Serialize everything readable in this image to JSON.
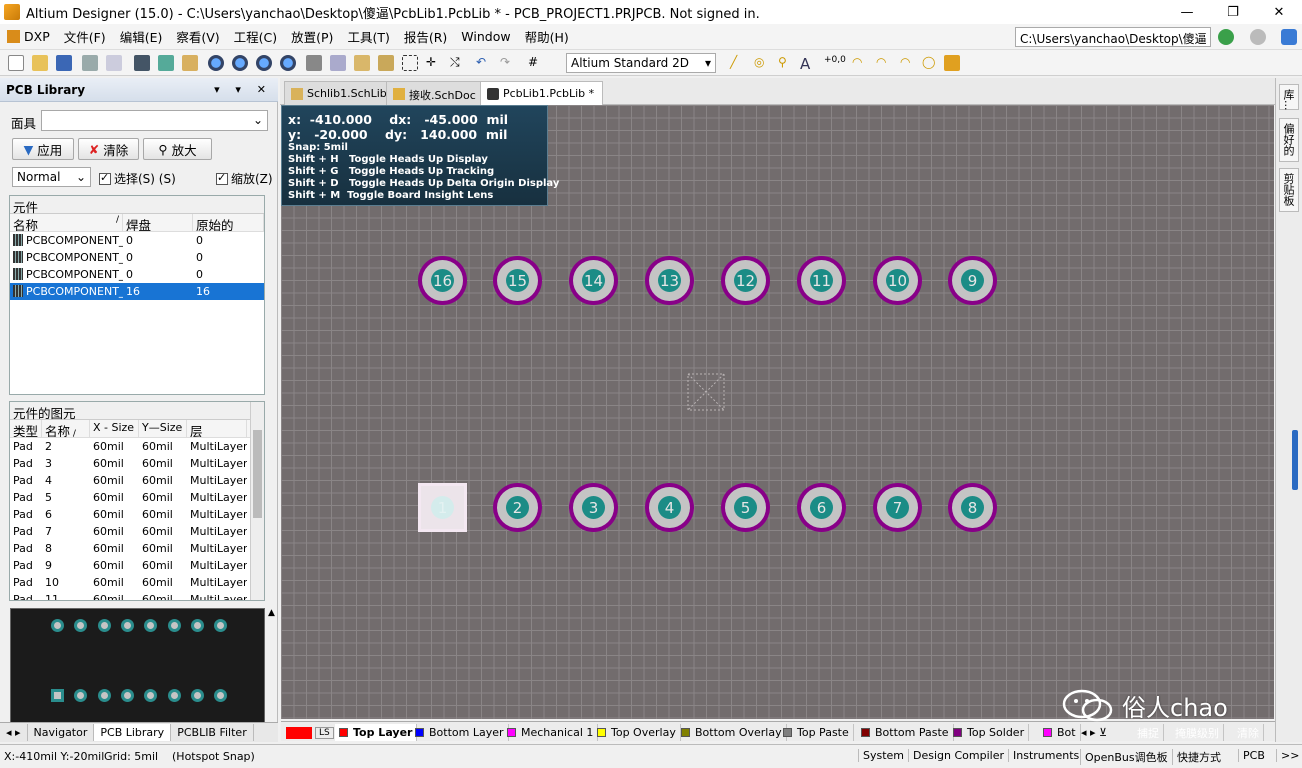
{
  "window": {
    "title": "Altium Designer (15.0) - C:\\Users\\yanchao\\Desktop\\傻逼\\PcbLib1.PcbLib * - PCB_PROJECT1.PRJPCB. Not signed in."
  },
  "menu": [
    "DXP",
    "文件(F)",
    "编辑(E)",
    "察看(V)",
    "工程(C)",
    "放置(P)",
    "工具(T)",
    "报告(R)",
    "Window",
    "帮助(H)"
  ],
  "path_box": "C:\\Users\\yanchao\\Desktop\\傻逼 ▾",
  "toolbar": {
    "view_mode": "Altium Standard 2D"
  },
  "panel": {
    "title": "PCB Library",
    "mask_label": "面具",
    "apply": "应用",
    "clear": "清除",
    "zoom": "放大",
    "filter_mode": "Normal",
    "select_label": "选择(S) (S)",
    "scale_label": "缩放(Z) (Z)",
    "components": {
      "title": "元件",
      "headers": [
        "名称",
        "焊盘",
        "原始的"
      ],
      "rows": [
        {
          "name": "PCBCOMPONENT_",
          "pads": "0",
          "prims": "0"
        },
        {
          "name": "PCBCOMPONENT_",
          "pads": "0",
          "prims": "0"
        },
        {
          "name": "PCBCOMPONENT_",
          "pads": "0",
          "prims": "0"
        },
        {
          "name": "PCBCOMPONENT_",
          "pads": "16",
          "prims": "16"
        }
      ]
    },
    "primitives": {
      "title": "元件的图元",
      "headers": [
        "类型",
        "名称",
        "X - Size",
        "Y—Size",
        "层"
      ],
      "rows": [
        {
          "type": "Pad",
          "name": "2",
          "x": "60mil",
          "y": "60mil",
          "layer": "MultiLayer"
        },
        {
          "type": "Pad",
          "name": "3",
          "x": "60mil",
          "y": "60mil",
          "layer": "MultiLayer"
        },
        {
          "type": "Pad",
          "name": "4",
          "x": "60mil",
          "y": "60mil",
          "layer": "MultiLayer"
        },
        {
          "type": "Pad",
          "name": "5",
          "x": "60mil",
          "y": "60mil",
          "layer": "MultiLayer"
        },
        {
          "type": "Pad",
          "name": "6",
          "x": "60mil",
          "y": "60mil",
          "layer": "MultiLayer"
        },
        {
          "type": "Pad",
          "name": "7",
          "x": "60mil",
          "y": "60mil",
          "layer": "MultiLayer"
        },
        {
          "type": "Pad",
          "name": "8",
          "x": "60mil",
          "y": "60mil",
          "layer": "MultiLayer"
        },
        {
          "type": "Pad",
          "name": "9",
          "x": "60mil",
          "y": "60mil",
          "layer": "MultiLayer"
        },
        {
          "type": "Pad",
          "name": "10",
          "x": "60mil",
          "y": "60mil",
          "layer": "MultiLayer"
        },
        {
          "type": "Pad",
          "name": "11",
          "x": "60mil",
          "y": "60mil",
          "layer": "MultiLayer"
        }
      ]
    },
    "tabs": [
      "Navigator",
      "PCB Library",
      "PCBLIB Filter"
    ]
  },
  "doc_tabs": [
    "Schlib1.SchLib",
    "接收.SchDoc",
    "PcbLib1.PcbLib *"
  ],
  "hud": {
    "line1": "x:  -410.000    dx:   -45.000  mil",
    "line2": "y:   -20.000    dy:   140.000  mil",
    "snap": "Snap: 5mil",
    "h": "Shift + H   Toggle Heads Up Display",
    "g": "Shift + G   Toggle Heads Up Tracking",
    "d": "Shift + D   Toggle Heads Up Delta Origin Display",
    "m": "Shift + M  Toggle Board Insight Lens"
  },
  "pads_top": [
    "16",
    "15",
    "14",
    "13",
    "12",
    "11",
    "10",
    "9"
  ],
  "pads_bottom": [
    "1",
    "2",
    "3",
    "4",
    "5",
    "6",
    "7",
    "8"
  ],
  "right_tabs": [
    "库...",
    "偏好的",
    "剪贴板"
  ],
  "layers": [
    {
      "name": "LS",
      "color": "#ff0000"
    },
    {
      "name": "Top Layer",
      "color": "#ff0000"
    },
    {
      "name": "Bottom Layer",
      "color": "#0000ff"
    },
    {
      "name": "Mechanical 1",
      "color": "#ff00ff"
    },
    {
      "name": "Top Overlay",
      "color": "#ffff00"
    },
    {
      "name": "Bottom Overlay",
      "color": "#808000"
    },
    {
      "name": "Top Paste",
      "color": "#808080"
    },
    {
      "name": "Bottom Paste",
      "color": "#800000"
    },
    {
      "name": "Top Solder",
      "color": "#800080"
    },
    {
      "name": "Bot",
      "color": "#ff00ff"
    }
  ],
  "layer_actions": [
    "捕捉",
    "掩膜级别",
    "清除"
  ],
  "status": {
    "coords": "X:-410mil Y:-20mil",
    "grid": "Grid: 5mil",
    "snap": "(Hotspot Snap)",
    "panels": [
      "System",
      "Design Compiler",
      "Instruments",
      "OpenBus调色板",
      "快捷方式",
      "PCB",
      ">>"
    ]
  },
  "watermark": "俗人chao"
}
